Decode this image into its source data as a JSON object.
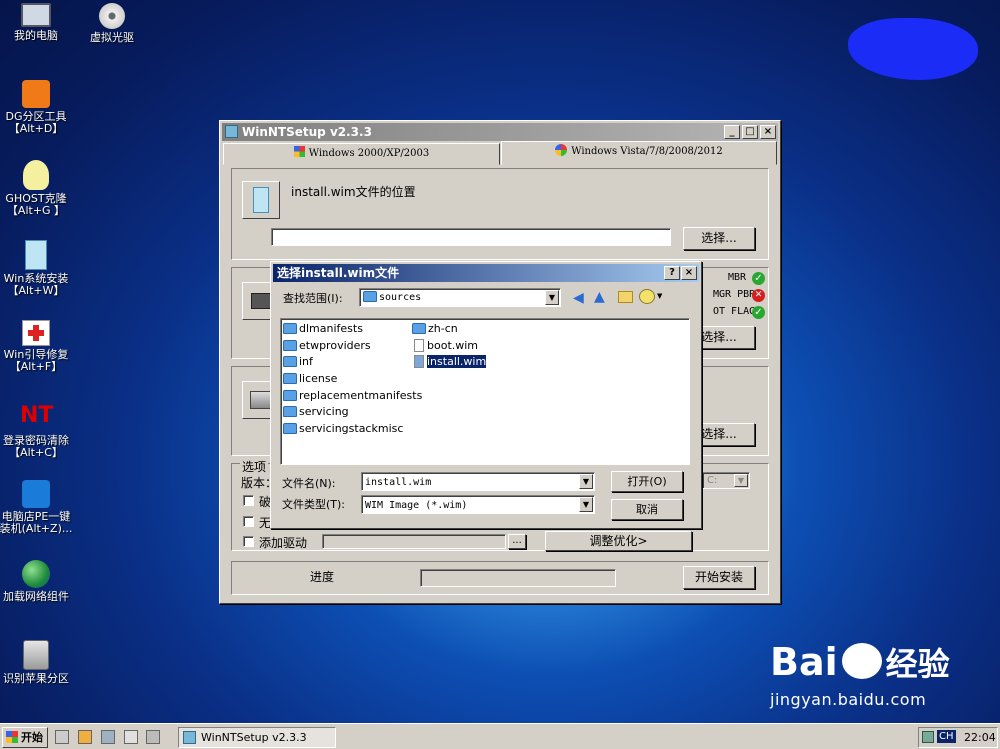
{
  "desktop": {
    "icons": [
      {
        "label": "我的电脑"
      },
      {
        "label": "虚拟光驱"
      },
      {
        "label": "DG分区工具\n【Alt+D】"
      },
      {
        "label": "GHOST克隆\n【Alt+G 】"
      },
      {
        "label": "Win系统安装\n【Alt+W】"
      },
      {
        "label": "Win引导修复\n【Alt+F】"
      },
      {
        "label": "登录密码清除\n【Alt+C】"
      },
      {
        "label": "电脑店PE一键\n装机(Alt+Z)..."
      },
      {
        "label": "加载网络组件"
      },
      {
        "label": "识别苹果分区"
      }
    ]
  },
  "window": {
    "title": "WinNTSetup v2.3.3",
    "min_label": "_",
    "max_label": "□",
    "close_label": "×",
    "tabs": [
      {
        "label": "Windows 2000/XP/2003"
      },
      {
        "label": "Windows Vista/7/8/2008/2012"
      }
    ],
    "wim_location_label": "install.wim文件的位置",
    "wim_path_value": "",
    "select_label": "选择...",
    "boot_status": [
      {
        "label": "MBR",
        "state": "ok"
      },
      {
        "label": "MGR PBR",
        "state": "error"
      },
      {
        "label": "OT FLAG",
        "state": "ok"
      }
    ],
    "options_label": "选项",
    "version_label": "版本：",
    "drive_value": "C:",
    "checkbox_partial_1": "破",
    "checkbox_partial_2": "无",
    "add_driver_label": "添加驱动",
    "browse_label": "...",
    "tweaks_label": "调整优化>",
    "progress_label": "进度",
    "install_label": "开始安装"
  },
  "dialog": {
    "title": "选择install.wim文件",
    "help_label": "?",
    "close_label": "×",
    "lookin_label": "查找范围(I):",
    "lookin_value": "sources",
    "files": [
      {
        "name": "dlmanifests",
        "type": "folder"
      },
      {
        "name": "etwproviders",
        "type": "folder"
      },
      {
        "name": "inf",
        "type": "folder"
      },
      {
        "name": "license",
        "type": "folder"
      },
      {
        "name": "replacementmanifests",
        "type": "folder"
      },
      {
        "name": "servicing",
        "type": "folder"
      },
      {
        "name": "servicingstackmisc",
        "type": "folder"
      },
      {
        "name": "zh-cn",
        "type": "folder"
      },
      {
        "name": "boot.wim",
        "type": "file"
      },
      {
        "name": "install.wim",
        "type": "file",
        "selected": true
      }
    ],
    "filename_label": "文件名(N):",
    "filename_value": "install.wim",
    "filetype_label": "文件类型(T):",
    "filetype_value": "WIM Image (*.wim)",
    "open_label": "打开(O)",
    "cancel_label": "取消"
  },
  "taskbar": {
    "start_label": "开始",
    "task_label": "WinNTSetup v2.3.3",
    "lang": "CH",
    "time": "22:04"
  },
  "watermark": {
    "brand": "Bai",
    "brand2": "经验",
    "url": "jingyan.baidu.com"
  },
  "colors": {
    "titlebar_active": "#0a246a",
    "titlebar_inactive": "#808080",
    "ok": "#28a830",
    "error": "#d42020"
  }
}
